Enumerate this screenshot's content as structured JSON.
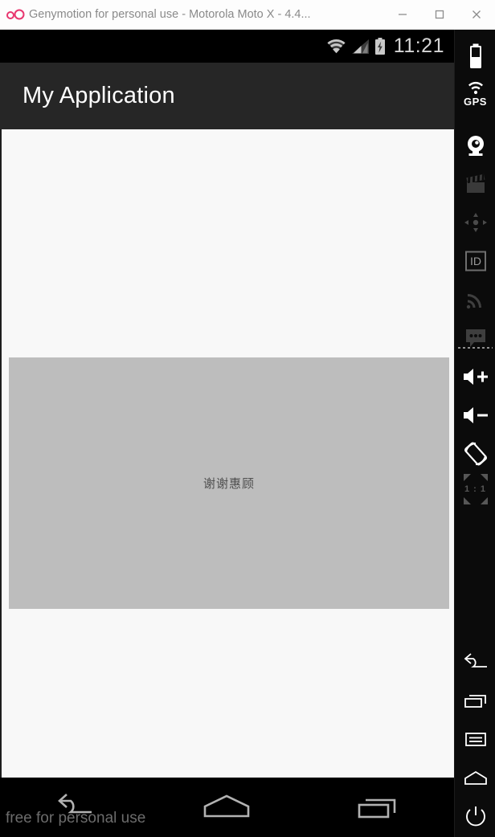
{
  "window": {
    "logo_name": "genymotion-logo",
    "title": "Genymotion for personal use - Motorola Moto X - 4.4...",
    "controls": [
      {
        "name": "minimize-button",
        "label": "Minimize"
      },
      {
        "name": "maximize-button",
        "label": "Maximize"
      },
      {
        "name": "close-button",
        "label": "Close"
      }
    ]
  },
  "device": {
    "status_bar": {
      "clock": "11:21",
      "icons": [
        "wifi-icon",
        "cellular-signal-icon",
        "battery-charging-icon"
      ]
    },
    "app_bar": {
      "title": "My Application"
    },
    "content": {
      "panel_text": "谢谢惠顾",
      "panel_color": "#bdbdbd",
      "background_color": "#f8f8f8"
    },
    "nav_bar": {
      "watermark": "free for personal use",
      "buttons": [
        {
          "name": "nav-back-button",
          "label": "Back"
        },
        {
          "name": "nav-home-button",
          "label": "Home"
        },
        {
          "name": "nav-recents-button",
          "label": "Recent apps"
        }
      ]
    }
  },
  "toolbar": {
    "items": [
      {
        "name": "battery-widget-icon",
        "label": "Battery",
        "enabled": true
      },
      {
        "name": "gps-widget-icon",
        "label": "GPS",
        "enabled": true
      },
      {
        "name": "camera-widget-icon",
        "label": "Camera",
        "enabled": true
      },
      {
        "name": "screencast-widget-icon",
        "label": "Screencast",
        "enabled": false
      },
      {
        "name": "dpad-widget-icon",
        "label": "D-Pad",
        "enabled": false
      },
      {
        "name": "identifiers-widget-icon",
        "label": "Identifiers",
        "enabled": true
      },
      {
        "name": "network-widget-icon",
        "label": "Network",
        "enabled": false
      },
      {
        "name": "sms-widget-icon",
        "label": "SMS / Phone",
        "enabled": false
      },
      {
        "name": "volume-up-button",
        "label": "Volume up",
        "enabled": true
      },
      {
        "name": "volume-down-button",
        "label": "Volume down",
        "enabled": true
      },
      {
        "name": "rotate-button",
        "label": "Rotate",
        "enabled": true
      },
      {
        "name": "scale-one-to-one-button",
        "label": "1 : 1",
        "enabled": false
      },
      {
        "name": "back-button",
        "label": "Back",
        "enabled": true
      },
      {
        "name": "recent-apps-button",
        "label": "Recent apps",
        "enabled": true
      },
      {
        "name": "menu-button",
        "label": "Menu",
        "enabled": true
      },
      {
        "name": "home-button",
        "label": "Home",
        "enabled": true
      },
      {
        "name": "power-button",
        "label": "Power",
        "enabled": true
      }
    ],
    "scale_label": "1 : 1",
    "gps_label": "GPS"
  }
}
